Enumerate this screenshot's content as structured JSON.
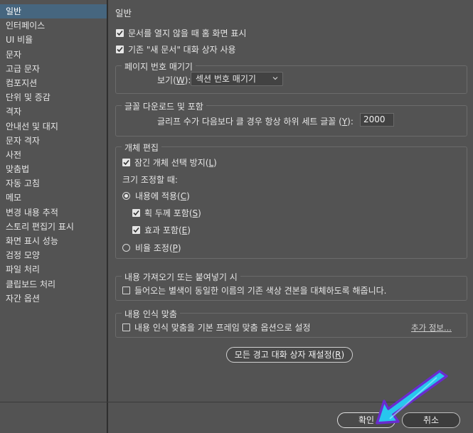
{
  "sidebar": {
    "items": [
      {
        "label": "일반",
        "selected": true
      },
      {
        "label": "인터페이스"
      },
      {
        "label": "UI 비율"
      },
      {
        "label": "문자"
      },
      {
        "label": "고급 문자"
      },
      {
        "label": "컴포지션"
      },
      {
        "label": "단위 및 증감"
      },
      {
        "label": "격자"
      },
      {
        "label": "안내선 및 대지"
      },
      {
        "label": "문자 격자"
      },
      {
        "label": "사전"
      },
      {
        "label": "맞춤법"
      },
      {
        "label": "자동 고침"
      },
      {
        "label": "메모"
      },
      {
        "label": "변경 내용 추적"
      },
      {
        "label": "스토리 편집기 표시"
      },
      {
        "label": "화면 표시 성능"
      },
      {
        "label": "검정 모양"
      },
      {
        "label": "파일 처리"
      },
      {
        "label": "클립보드 처리"
      },
      {
        "label": "자간 옵션"
      }
    ]
  },
  "main": {
    "title": "일반",
    "options": {
      "home_screen": {
        "label": "문서를 열지 않을 때 홈 화면 표시",
        "checked": true
      },
      "legacy_new_doc": {
        "label": "기존 \"새 문서\" 대화 상자 사용",
        "checked": true
      }
    },
    "page_numbering": {
      "legend": "페이지 번호 매기기",
      "view_label_prefix": "보기(",
      "view_label_key": "W",
      "view_label_suffix": "):",
      "view_value": "섹션 번호 매기기"
    },
    "font_download": {
      "legend": "글꼴 다운로드 및 포함",
      "glyph_label_prefix": "글리프 수가 다음보다 클 경우 항상 하위 세트 글꼴 (",
      "glyph_label_key": "Y",
      "glyph_label_suffix": "):",
      "glyph_value": "2000"
    },
    "object_editing": {
      "legend": "개체 편집",
      "prevent_locked": {
        "prefix": "잠긴 개체 선택 방지(",
        "key": "L",
        "suffix": ")",
        "checked": true
      },
      "scaling_label": "크기 조정할 때:",
      "apply_to_content": {
        "prefix": "내용에 적용(",
        "key": "C",
        "suffix": ")",
        "selected": true
      },
      "include_stroke": {
        "prefix": "획 두께 포함(",
        "key": "S",
        "suffix": ")",
        "checked": true
      },
      "include_effects": {
        "prefix": "효과 포함(",
        "key": "E",
        "suffix": ")",
        "checked": true
      },
      "adjust_scale": {
        "prefix": "비율 조정(",
        "key": "P",
        "suffix": ")",
        "selected": false
      }
    },
    "import_paste": {
      "legend": "내용 가져오기 또는 붙여넣기 시",
      "replace_swatch": {
        "label": "들어오는 별색이 동일한 이름의 기존 색상 견본을 대체하도록 해줍니다.",
        "checked": false
      }
    },
    "content_aware_fit": {
      "legend": "내용 인식 맞춤",
      "set_default": {
        "label": "내용 인식 맞춤을 기본 프레임 맞춤 옵션으로 설정",
        "checked": false
      },
      "more_info": "추가 정보..."
    },
    "reset_warnings": {
      "prefix": "모든 경고 대화 상자 재설정(",
      "key": "R",
      "suffix": ")"
    }
  },
  "footer": {
    "ok_label": "확인",
    "cancel_label": "취소"
  },
  "colors": {
    "panel": "#535353",
    "selection": "#46667f",
    "arrow_fill": "#27c6ee",
    "arrow_outline": "#6a2ccf"
  },
  "icons": {
    "dropdown": "chevron-down-icon",
    "checkbox": "checkmark-icon",
    "pointer": "arrow-pointer-icon"
  }
}
